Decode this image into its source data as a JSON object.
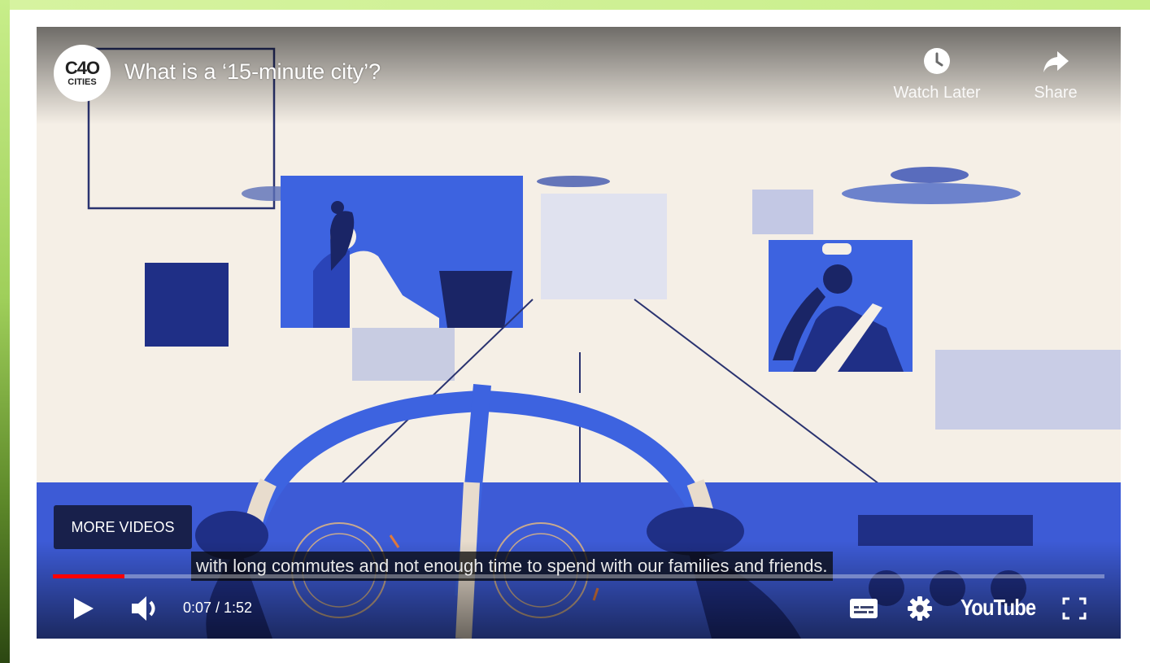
{
  "video": {
    "title": "What is a ‘15-minute city’?",
    "channel_logo_line1": "C4O",
    "channel_logo_line2": "CITIES"
  },
  "top_actions": {
    "watch_later_label": "Watch Later",
    "watch_later_icon": "clock-icon",
    "share_label": "Share",
    "share_icon": "share-arrow-icon"
  },
  "more_videos_label": "MORE VIDEOS",
  "caption_text": "with long commutes and not enough time to spend with our families and friends.",
  "playback": {
    "current_time": "0:07",
    "duration": "1:52",
    "time_display": "0:07 / 1:52",
    "progress_fraction": 0.068
  },
  "controls": {
    "play_icon": "play-icon",
    "volume_icon": "volume-icon",
    "subtitles_icon": "subtitles-icon",
    "settings_icon": "gear-icon",
    "youtube_label": "YouTube",
    "fullscreen_icon": "fullscreen-icon"
  },
  "colors": {
    "progress_played": "#ff0000",
    "illustration_blue": "#3d63e0",
    "illustration_navy": "#1f2f86",
    "illustration_background": "#f5efe6",
    "frame_green": "#c8ee8a"
  }
}
